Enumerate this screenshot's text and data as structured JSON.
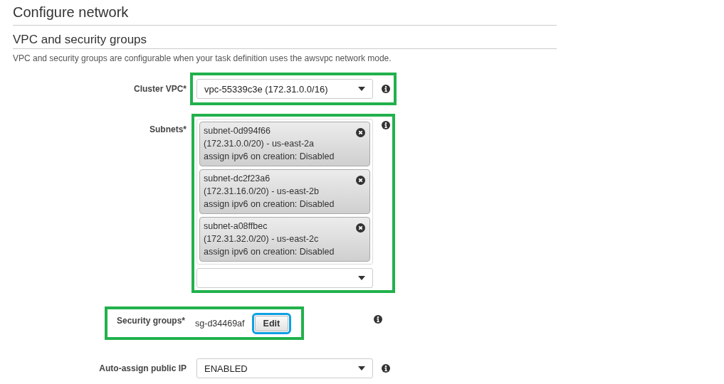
{
  "page_title": "Configure network",
  "section": {
    "title": "VPC and security groups",
    "description": "VPC and security groups are configurable when your task definition uses the awsvpc network mode."
  },
  "fields": [
    {
      "kind": "select",
      "label": "Cluster VPC*",
      "value": "vpc-55339c3e (172.31.0.0/16)",
      "highlighted": true
    },
    {
      "kind": "multiselect",
      "label": "Subnets*",
      "highlighted": true,
      "items": [
        {
          "lines": [
            "subnet-0d994f66",
            "(172.31.0.0/20) - us-east-2a",
            "assign ipv6 on creation: Disabled"
          ]
        },
        {
          "lines": [
            "subnet-dc2f23a6",
            "(172.31.16.0/20) - us-east-2b",
            "assign ipv6 on creation: Disabled"
          ]
        },
        {
          "lines": [
            "subnet-a08ffbec",
            "(172.31.32.0/20) - us-east-2c",
            "assign ipv6 on creation: Disabled"
          ]
        }
      ]
    },
    {
      "kind": "button-value",
      "label": "Security groups*",
      "value": "sg-d34469af",
      "highlighted": true,
      "button": {
        "label": "Edit",
        "highlighted": true
      }
    },
    {
      "kind": "select",
      "label": "Auto-assign public IP",
      "value": "ENABLED",
      "highlighted": false
    }
  ]
}
